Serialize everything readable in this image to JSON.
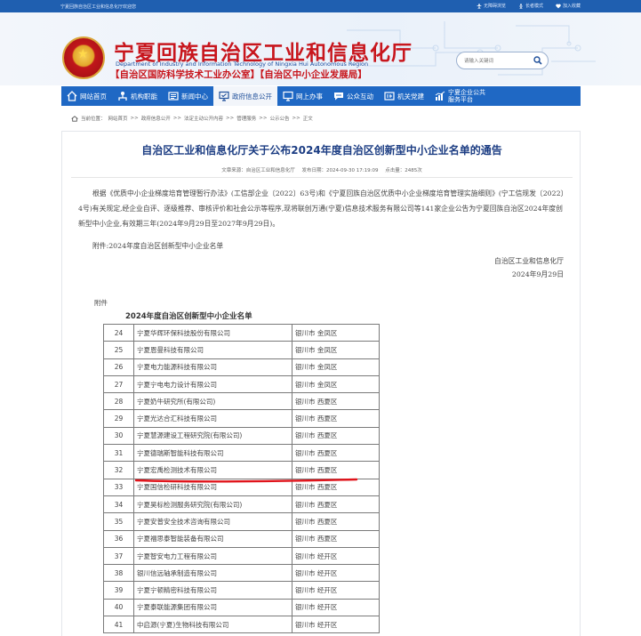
{
  "topbar": {
    "welcome": "宁夏回族自治区工业和信息化厅欢迎您",
    "links": [
      {
        "icon": "accessibility-icon",
        "label": "无障碍浏览"
      },
      {
        "icon": "elder-mode-icon",
        "label": "长者模式"
      },
      {
        "icon": "favorite-icon",
        "label": "加入收藏"
      }
    ]
  },
  "header": {
    "title_cn": "宁夏回族自治区工业和信息化厅",
    "title_en": "Department of Industry and Information Technology of Ningxia Hui Autonomous Region",
    "subtitle": "【自治区国防科学技术工业办公室】【自治区中小企业发展局】",
    "search_placeholder": "请输入关键词"
  },
  "nav": {
    "items": [
      {
        "icon": "home-icon",
        "label": "网站首页"
      },
      {
        "icon": "org-icon",
        "label": "机构职能"
      },
      {
        "icon": "news-icon",
        "label": "新闻中心"
      },
      {
        "icon": "gov-info-icon",
        "label": "政府信息公开",
        "active": true
      },
      {
        "icon": "online-service-icon",
        "label": "网上办事"
      },
      {
        "icon": "interaction-icon",
        "label": "公众互动"
      },
      {
        "icon": "party-icon",
        "label": "机关党建"
      },
      {
        "icon": "sme-platform-icon",
        "label_line1": "宁夏企业公共",
        "label_line2": "服务平台"
      }
    ]
  },
  "breadcrumb": [
    "当前位置：",
    "网站首页",
    ">>",
    "政府信息公开",
    ">>",
    "法定主动公开内容",
    ">>",
    "管理服务",
    ">>",
    "公示公告",
    ">>",
    "正文"
  ],
  "article": {
    "title": "自治区工业和信息化厅关于公布2024年度自治区创新型中小企业名单的通告",
    "source": "文章来源：自治区工业和信息化厅",
    "date": "发布日期：2024-09-30 17:19:09",
    "views": "点击量：2485次",
    "paragraph": "根据《优质中小企业梯度培育管理暂行办法》(工信部企业〔2022〕63号)和《宁夏回族自治区优质中小企业梯度培育管理实施细则》(宁工信规发〔2022〕4号)有关规定,经企业自评、逐级推荐、审核评价和社会公示等程序,现将联创万通(宁夏)信息技术服务有限公司等141家企业公告为宁夏回族自治区2024年度创新型中小企业,有效期三年(2024年9月29日至2027年9月29日)。",
    "attachment_line": "附件:2024年度自治区创新型中小企业名单",
    "sign_org": "自治区工业和信息化厅",
    "sign_date": "2024年9月29日",
    "attachment_label": "附件",
    "table_title": "2024年度自治区创新型中小企业名单"
  },
  "table_rows": [
    {
      "no": "24",
      "name": "宁夏华辉环保科技股份有限公司",
      "area": "银川市 金凤区"
    },
    {
      "no": "25",
      "name": "宁夏恩曼科技有限公司",
      "area": "银川市 金凤区"
    },
    {
      "no": "26",
      "name": "宁夏电力能源科技有限公司",
      "area": "银川市 金凤区"
    },
    {
      "no": "27",
      "name": "宁夏宁电电力设计有限公司",
      "area": "银川市 金凤区"
    },
    {
      "no": "28",
      "name": "宁夏奶牛研究所(有限公司)",
      "area": "银川市 西夏区"
    },
    {
      "no": "29",
      "name": "宁夏光达合汇科技有限公司",
      "area": "银川市 西夏区"
    },
    {
      "no": "30",
      "name": "宁夏慧源建设工程研究院(有限公司)",
      "area": "银川市 西夏区"
    },
    {
      "no": "31",
      "name": "宁夏德瑞斯智能科技有限公司",
      "area": "银川市 西夏区"
    },
    {
      "no": "32",
      "name": "宁夏宏禹检测技术有限公司",
      "area": "银川市 西夏区"
    },
    {
      "no": "33",
      "name": "宁夏国信检研科技有限公司",
      "area": "银川市 西夏区"
    },
    {
      "no": "34",
      "name": "宁夏昊标检测服务研究院(有限公司)",
      "area": "银川市 西夏区"
    },
    {
      "no": "35",
      "name": "宁夏安普安全技术咨询有限公司",
      "area": "银川市 西夏区"
    },
    {
      "no": "36",
      "name": "宁夏福思泰智能装备有限公司",
      "area": "银川市 西夏区"
    },
    {
      "no": "37",
      "name": "宁夏智安电力工程有限公司",
      "area": "银川市 经开区"
    },
    {
      "no": "38",
      "name": "银川信远轴承制造有限公司",
      "area": "银川市 经开区"
    },
    {
      "no": "39",
      "name": "宁夏宁顿精密科技有限公司",
      "area": "银川市 经开区"
    },
    {
      "no": "40",
      "name": "宁夏泰联能源集团有限公司",
      "area": "银川市 经开区"
    },
    {
      "no": "41",
      "name": "中启源(宁夏)生物科技有限公司",
      "area": "银川市 经开区"
    }
  ],
  "colors": {
    "topbar": "#1f5fb0",
    "nav": "#1f68c4",
    "title_red": "#c8161d",
    "article_title": "#1c3d83",
    "highlight_underline": "#e0141b"
  }
}
